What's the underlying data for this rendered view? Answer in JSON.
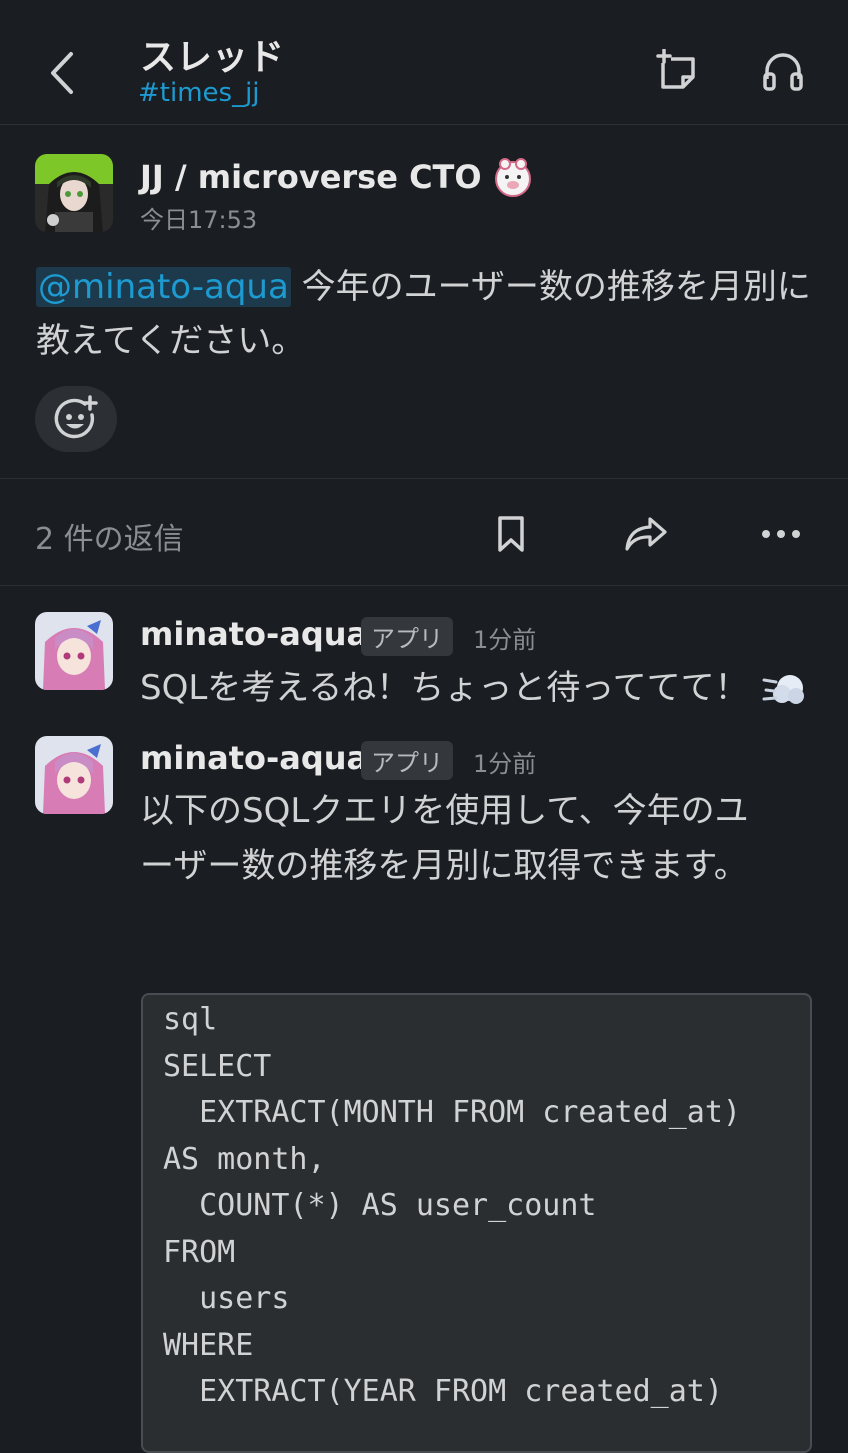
{
  "header": {
    "title": "スレッド",
    "channel": "#times_jj"
  },
  "root_message": {
    "author": "JJ / microverse CTO",
    "timestamp": "今日17:53",
    "mention": "@minato-aqua",
    "text": " 今年のユーザー数の推移を月別に教えてください。"
  },
  "reply_bar": {
    "count_label": "2 件の返信"
  },
  "replies": [
    {
      "author": "minato-aqua",
      "badge": "アプリ",
      "time": "1分前",
      "text": "SQLを考えるね！ちょっと待っててて！"
    },
    {
      "author": "minato-aqua",
      "badge": "アプリ",
      "time": "1分前",
      "text": "以下のSQLクエリを使用して、今年のユーザー数の推移を月別に取得できます。",
      "code": "sql\nSELECT\n  EXTRACT(MONTH FROM created_at)\nAS month,\n  COUNT(*) AS user_count\nFROM\n  users\nWHERE\n  EXTRACT(YEAR FROM created_at)"
    }
  ],
  "colors": {
    "background": "#1a1d21",
    "link": "#1d9bd1",
    "mention_bg": "#1d3a4d"
  }
}
